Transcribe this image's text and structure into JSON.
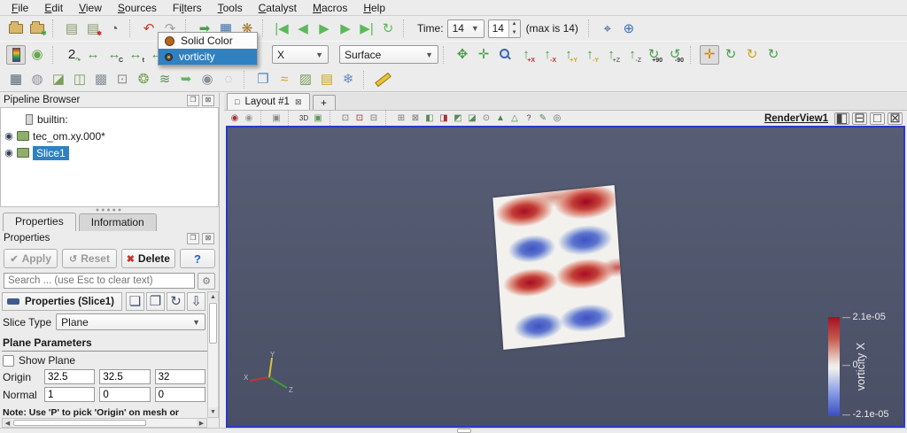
{
  "menu": {
    "items": [
      {
        "label": "File",
        "m": 0
      },
      {
        "label": "Edit",
        "m": 0
      },
      {
        "label": "View",
        "m": 0
      },
      {
        "label": "Sources",
        "m": 0
      },
      {
        "label": "Filters",
        "m": 2
      },
      {
        "label": "Tools",
        "m": 0
      },
      {
        "label": "Catalyst",
        "m": 0
      },
      {
        "label": "Macros",
        "m": 0
      },
      {
        "label": "Help",
        "m": 0
      }
    ]
  },
  "colors": {
    "selection": "#2f81c1",
    "view_border": "#2b38c9",
    "legend_red": "#a50f23",
    "legend_blue": "#3b4cc0",
    "render_bg": "#525769"
  },
  "toolbar1": {
    "icons_a": [
      {
        "n": "open-file-icon",
        "t": "folder"
      },
      {
        "n": "load-state-icon",
        "t": "folder",
        "star": true
      },
      {
        "sep": true
      },
      {
        "n": "connect-server-icon",
        "g": "▤",
        "c": "#8a9a6a"
      },
      {
        "n": "disconnect-server-icon",
        "g": "▤",
        "c": "#8a9a6a",
        "sub": "✱",
        "subc": "#c03030"
      },
      {
        "n": "timer-icon",
        "g": "◔",
        "c": "#5a6472"
      },
      {
        "sep": true
      },
      {
        "n": "undo-icon",
        "g": "↶",
        "c": "#c0392b"
      },
      {
        "n": "redo-icon",
        "g": "↷",
        "c": "#9aa0a6"
      },
      {
        "sep": true
      },
      {
        "n": "auto-apply-icon",
        "g": "➡",
        "c": "#4a9e4a"
      },
      {
        "n": "vtk-colors-icon",
        "g": "▦",
        "c": "#3a6ea5"
      },
      {
        "n": "color-palette-icon",
        "g": "❋",
        "c": "#a5742a"
      },
      {
        "sep": true
      },
      {
        "n": "first-frame-icon",
        "g": "|◀",
        "c": "#5cb85c"
      },
      {
        "n": "previous-frame-icon",
        "g": "◀",
        "c": "#5cb85c"
      },
      {
        "n": "play-icon",
        "g": "▶",
        "c": "#5cb85c"
      },
      {
        "n": "next-frame-icon",
        "g": "▶",
        "c": "#5cb85c"
      },
      {
        "n": "last-frame-icon",
        "g": "▶|",
        "c": "#5cb85c"
      },
      {
        "n": "loop-icon",
        "g": "↻",
        "c": "#5cb85c"
      },
      {
        "sep": true
      }
    ],
    "icons_b": [
      {
        "sep": true
      },
      {
        "n": "zoom-closest-link-icon",
        "g": "⌖",
        "c": "#33508a"
      },
      {
        "n": "add-camera-link-icon",
        "g": "⊕",
        "c": "#3a6ec0"
      }
    ],
    "time_label": "Time:",
    "time_combo_value": "14",
    "time_spin_value": "14",
    "max_label": "(max is 14)"
  },
  "toolbar2": {
    "icons_left": [
      {
        "n": "edit-colormap-icon",
        "t": "cmap",
        "pressed": true
      },
      {
        "n": "set-solid-color-icon",
        "g": "◉",
        "c": "#6aa84f"
      },
      {
        "sep": true
      },
      {
        "n": "rescale-to-data-icon",
        "g": "2",
        "c": "#222",
        "sub": "↷",
        "subc": "#4a9e4a"
      },
      {
        "n": "rescale-custom-icon",
        "g": "↔",
        "c": "#4a9e4a"
      },
      {
        "n": "rescale-custom-range-icon",
        "g": "↔",
        "c": "#4a9e4a",
        "sub": "C"
      },
      {
        "n": "rescale-temporal-icon",
        "g": "↔",
        "c": "#4a9e4a",
        "sub": "t"
      },
      {
        "n": "rescale-visible-icon",
        "g": "↔",
        "c": "#4a9e4a",
        "sub": "◉"
      }
    ],
    "component_combo_value": "X",
    "representation_combo_value": "Surface",
    "camera_icons": [
      {
        "n": "reset-camera-icon",
        "g": "✥",
        "c": "#4a9e4a"
      },
      {
        "n": "zoom-to-data-icon",
        "g": "✛",
        "c": "#4a9e4a"
      },
      {
        "n": "zoom-to-box-icon",
        "t": "lens"
      },
      {
        "n": "view-plus-x-icon",
        "g": "↑",
        "c": "#4a9e4a",
        "sub": "+X",
        "subc": "#c03030"
      },
      {
        "n": "view-minus-x-icon",
        "g": "↑",
        "c": "#4a9e4a",
        "sub": "-X",
        "subc": "#c03030"
      },
      {
        "n": "view-plus-y-icon",
        "g": "↑",
        "c": "#4a9e4a",
        "sub": "+Y",
        "subc": "#caa520"
      },
      {
        "n": "view-minus-y-icon",
        "g": "↑",
        "c": "#4a9e4a",
        "sub": "-Y",
        "subc": "#caa520"
      },
      {
        "n": "view-plus-z-icon",
        "g": "↑",
        "c": "#4a9e4a",
        "sub": "+Z",
        "subc": "#777"
      },
      {
        "n": "view-minus-z-icon",
        "g": "↑",
        "c": "#4a9e4a",
        "sub": "-Z",
        "subc": "#777"
      },
      {
        "n": "rotate-90-cw-icon",
        "g": "↻",
        "c": "#4a9e4a",
        "sub": "+90"
      },
      {
        "n": "rotate-90-ccw-icon",
        "g": "↺",
        "c": "#4a9e4a",
        "sub": "-90"
      },
      {
        "sep": true
      },
      {
        "n": "orientation-axes-toggle-icon",
        "g": "✛",
        "c": "#cc8800",
        "pressed": true
      },
      {
        "n": "rotate-camera-cw-icon",
        "g": "↻",
        "c": "#4a9e4a"
      },
      {
        "n": "rotate-camera-center-icon",
        "g": "↻",
        "c": "#caa520"
      },
      {
        "n": "mouse-rotate-icon",
        "g": "↻",
        "c": "#4a9e4a"
      }
    ]
  },
  "toolbar3": {
    "icons": [
      {
        "n": "calculator-icon",
        "g": "▦",
        "c": "#5a6472"
      },
      {
        "n": "contour-icon",
        "g": "◍",
        "c": "#8a8f99"
      },
      {
        "n": "clip-icon",
        "g": "◪",
        "c": "#7a9f5a"
      },
      {
        "n": "slice-icon",
        "g": "◫",
        "c": "#7a9f5a"
      },
      {
        "n": "threshold-icon",
        "g": "▩",
        "c": "#8a8f99"
      },
      {
        "n": "extract-subset-icon",
        "g": "⊡",
        "c": "#8a8f99"
      },
      {
        "n": "glyph-icon",
        "g": "❂",
        "c": "#7a9f5a"
      },
      {
        "n": "stream-tracer-icon",
        "g": "≋",
        "c": "#5a8f5a"
      },
      {
        "n": "warp-icon",
        "g": "➥",
        "c": "#5cb85c"
      },
      {
        "n": "group-datasets-icon",
        "g": "◉",
        "c": "#8a8f99"
      },
      {
        "n": "extract-level-icon",
        "g": "◌",
        "c": "#a8adb8"
      },
      {
        "sep": true
      },
      {
        "n": "extract-block-icon",
        "g": "❐",
        "c": "#4a84c4"
      },
      {
        "n": "plot-over-line-icon",
        "g": "≈",
        "c": "#caa520"
      },
      {
        "n": "plot-selection-icon",
        "g": "▨",
        "c": "#7a9f5a"
      },
      {
        "n": "plot-global-variables-icon",
        "g": "▤",
        "c": "#caa520"
      },
      {
        "n": "probe-location-icon",
        "g": "❄",
        "c": "#6a8ac4"
      },
      {
        "sep": true
      },
      {
        "n": "ruler-icon",
        "t": "ruler"
      }
    ]
  },
  "dropdown": {
    "items": [
      {
        "label": "Solid Color"
      },
      {
        "label": "vorticity"
      }
    ]
  },
  "pipeline": {
    "title": "Pipeline Browser",
    "builtin_label": "builtin:",
    "source_label": "tec_om.xy.000*",
    "slice_label": "Slice1",
    "header_icons": [
      {
        "n": "undock-icon",
        "g": "❐"
      },
      {
        "n": "close-icon",
        "g": "⊠"
      }
    ]
  },
  "tabs": {
    "properties": "Properties",
    "information": "Information"
  },
  "properties": {
    "title": "Properties",
    "header_icons": [
      {
        "n": "undock-icon",
        "g": "❐"
      },
      {
        "n": "close-icon",
        "g": "⊠"
      }
    ],
    "apply_label": "Apply",
    "reset_label": "Reset",
    "delete_label": "Delete",
    "help_label": "?",
    "search_placeholder": "Search ... (use Esc to clear text)",
    "section_header": "Properties (Slice1)",
    "section_icons": [
      {
        "n": "copy-icon",
        "g": "❏"
      },
      {
        "n": "paste-icon",
        "g": "❐"
      },
      {
        "n": "reset-defaults-icon",
        "g": "↻"
      },
      {
        "n": "save-defaults-icon",
        "g": "⇩"
      }
    ],
    "slice_type_label": "Slice Type",
    "slice_type_value": "Plane",
    "plane_params_header": "Plane Parameters",
    "show_plane_label": "Show Plane",
    "origin_label": "Origin",
    "origin_values": [
      "32.5",
      "32.5",
      "32"
    ],
    "normal_label": "Normal",
    "normal_values": [
      "1",
      "0",
      "0"
    ],
    "note": "Note: Use 'P' to pick 'Origin' on mesh or 'Ctrl+P' to snap to the closest mesh point"
  },
  "layout": {
    "tab_label": "Layout #1",
    "plus_label": "+"
  },
  "viewbar": {
    "icons": [
      {
        "n": "edit-camera-icon",
        "g": "◉",
        "c": "#a03333"
      },
      {
        "n": "adjust-camera-icon",
        "g": "◉",
        "c": "#999"
      },
      {
        "sep": true
      },
      {
        "n": "select-view-icon",
        "g": "▣",
        "c": "#888"
      },
      {
        "sep": true
      },
      {
        "n": "toggle-3d-icon",
        "g": "3D",
        "c": "#333",
        "fs": 8
      },
      {
        "n": "reset-center-icon",
        "g": "▣",
        "c": "#5a9a5a"
      },
      {
        "sep": true
      },
      {
        "n": "select-cells-on-icon",
        "g": "⊡",
        "c": "#777"
      },
      {
        "n": "select-points-on-icon",
        "g": "⊡",
        "c": "#a03333"
      },
      {
        "n": "select-frustum-cells-icon",
        "g": "⊟",
        "c": "#777"
      },
      {
        "sep": true
      },
      {
        "n": "select-frustum-points-icon",
        "g": "⊞",
        "c": "#777"
      },
      {
        "n": "select-polygon-cells-icon",
        "g": "⊠",
        "c": "#777"
      },
      {
        "n": "select-block-icon",
        "g": "◧",
        "c": "#5a8a5a"
      },
      {
        "n": "select-block-points-icon",
        "g": "◨",
        "c": "#a03333"
      },
      {
        "n": "interactive-select-cells-icon",
        "g": "◩",
        "c": "#5a8a5a"
      },
      {
        "n": "interactive-select-points-icon",
        "g": "◪",
        "c": "#5a8a5a"
      },
      {
        "n": "hover-cells-icon",
        "g": "⊙",
        "c": "#777"
      },
      {
        "n": "grow-selection-icon",
        "g": "▲",
        "c": "#4a8a4a"
      },
      {
        "n": "shrink-selection-icon",
        "g": "△",
        "c": "#4a8a4a"
      },
      {
        "n": "query-tooltip-icon",
        "g": "?",
        "c": "#444",
        "fs": 9
      },
      {
        "n": "edit-selection-icon",
        "g": "✎",
        "c": "#4a8a4a"
      },
      {
        "n": "center-axes-icon",
        "g": "◎",
        "c": "#666"
      }
    ],
    "renderview_label": "RenderView1",
    "window_icons": [
      {
        "n": "split-horizontal-icon",
        "g": "◧"
      },
      {
        "n": "split-vertical-icon",
        "g": "⊟"
      },
      {
        "n": "maximize-icon",
        "g": "□"
      },
      {
        "n": "close-view-icon",
        "g": "⊠"
      }
    ]
  },
  "legend": {
    "max": "2.1e-05",
    "zero": "0",
    "min": "-2.1e-05",
    "title": "vorticity X"
  },
  "axes": {
    "x": "X",
    "y": "Y",
    "z": "Z"
  }
}
